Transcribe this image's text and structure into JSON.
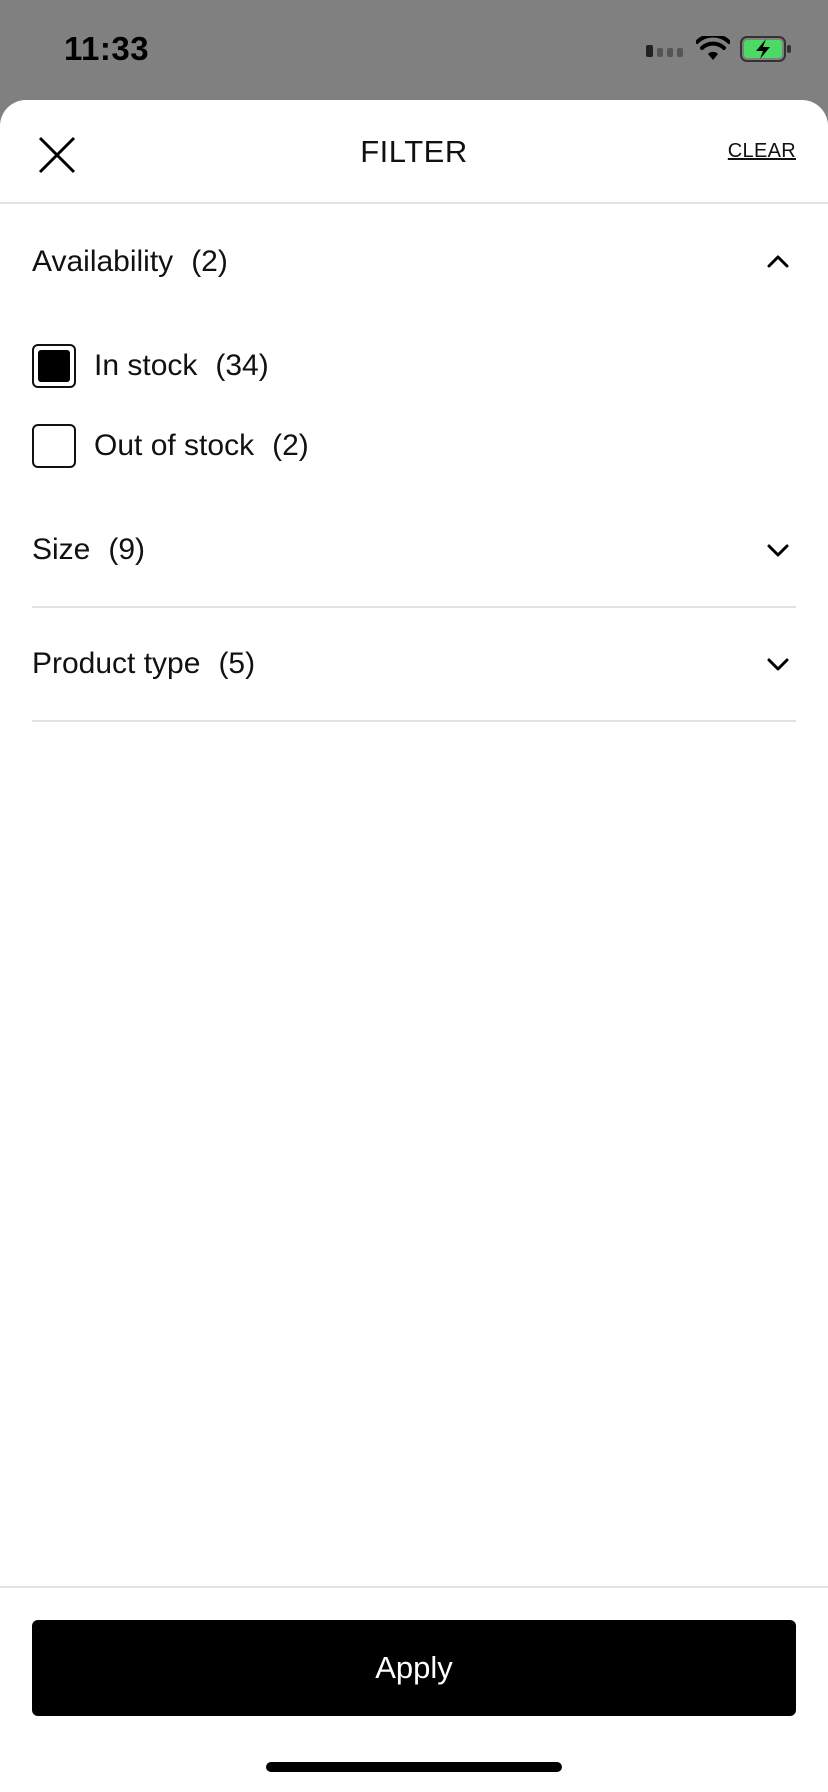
{
  "status_bar": {
    "time": "11:33"
  },
  "header": {
    "title": "FILTER",
    "clear_label": "CLEAR"
  },
  "sections": {
    "availability": {
      "label": "Availability",
      "count": "(2)",
      "expanded": true,
      "options": [
        {
          "label": "In stock",
          "count": "(34)",
          "checked": true
        },
        {
          "label": "Out of stock",
          "count": "(2)",
          "checked": false
        }
      ]
    },
    "size": {
      "label": "Size",
      "count": "(9)",
      "expanded": false
    },
    "product_type": {
      "label": "Product type",
      "count": "(5)",
      "expanded": false
    }
  },
  "footer": {
    "apply_label": "Apply"
  },
  "colors": {
    "overlay": "#808080",
    "sheet": "#ffffff",
    "primary": "#000000",
    "divider": "#e2e2e2",
    "battery_fill": "#4cd964"
  },
  "icons": {
    "close": "close-icon",
    "expanded": "chevron-up-icon",
    "collapsed": "chevron-down-icon"
  }
}
